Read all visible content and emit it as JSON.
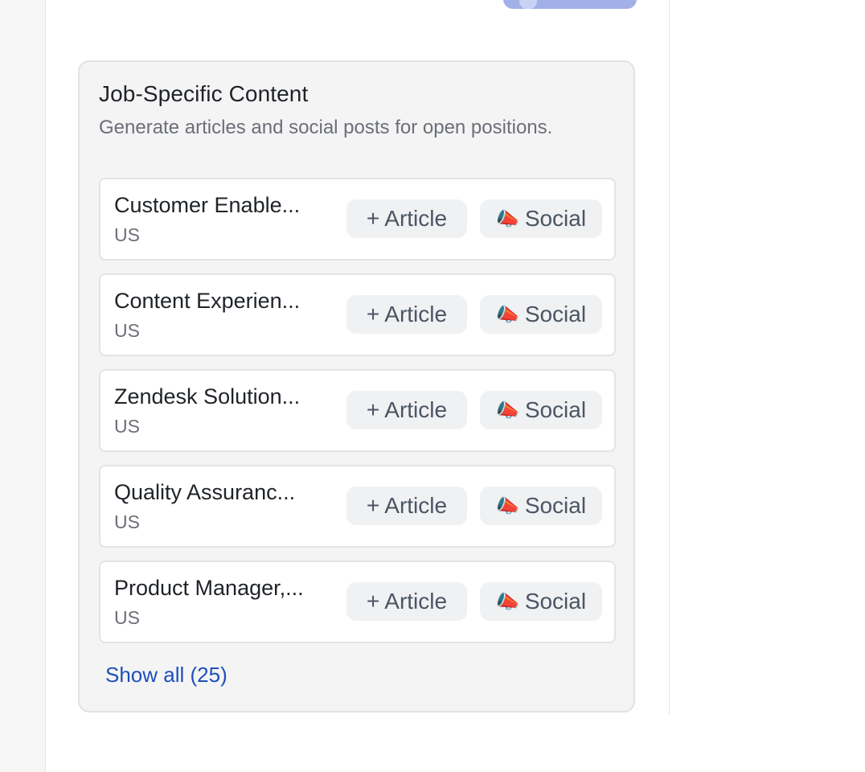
{
  "card": {
    "title": "Job-Specific Content",
    "description": "Generate articles and social posts for open positions."
  },
  "jobs": [
    {
      "title": "Customer Enable...",
      "location": "US",
      "article_label": "Article",
      "social_label": "Social"
    },
    {
      "title": "Content Experien...",
      "location": "US",
      "article_label": "Article",
      "social_label": "Social"
    },
    {
      "title": "Zendesk Solution...",
      "location": "US",
      "article_label": "Article",
      "social_label": "Social"
    },
    {
      "title": "Quality Assuranc...",
      "location": "US",
      "article_label": "Article",
      "social_label": "Social"
    },
    {
      "title": "Product Manager,...",
      "location": "US",
      "article_label": "Article",
      "social_label": "Social"
    }
  ],
  "icons": {
    "article": "plus-icon",
    "social": "megaphone-icon"
  },
  "show_all_label": "Show all (25)",
  "colors": {
    "link": "#1e4fb8",
    "pill_background": "#f0f1f3",
    "card_background": "#f4f4f5",
    "partial_button": "#a1b1e8"
  }
}
